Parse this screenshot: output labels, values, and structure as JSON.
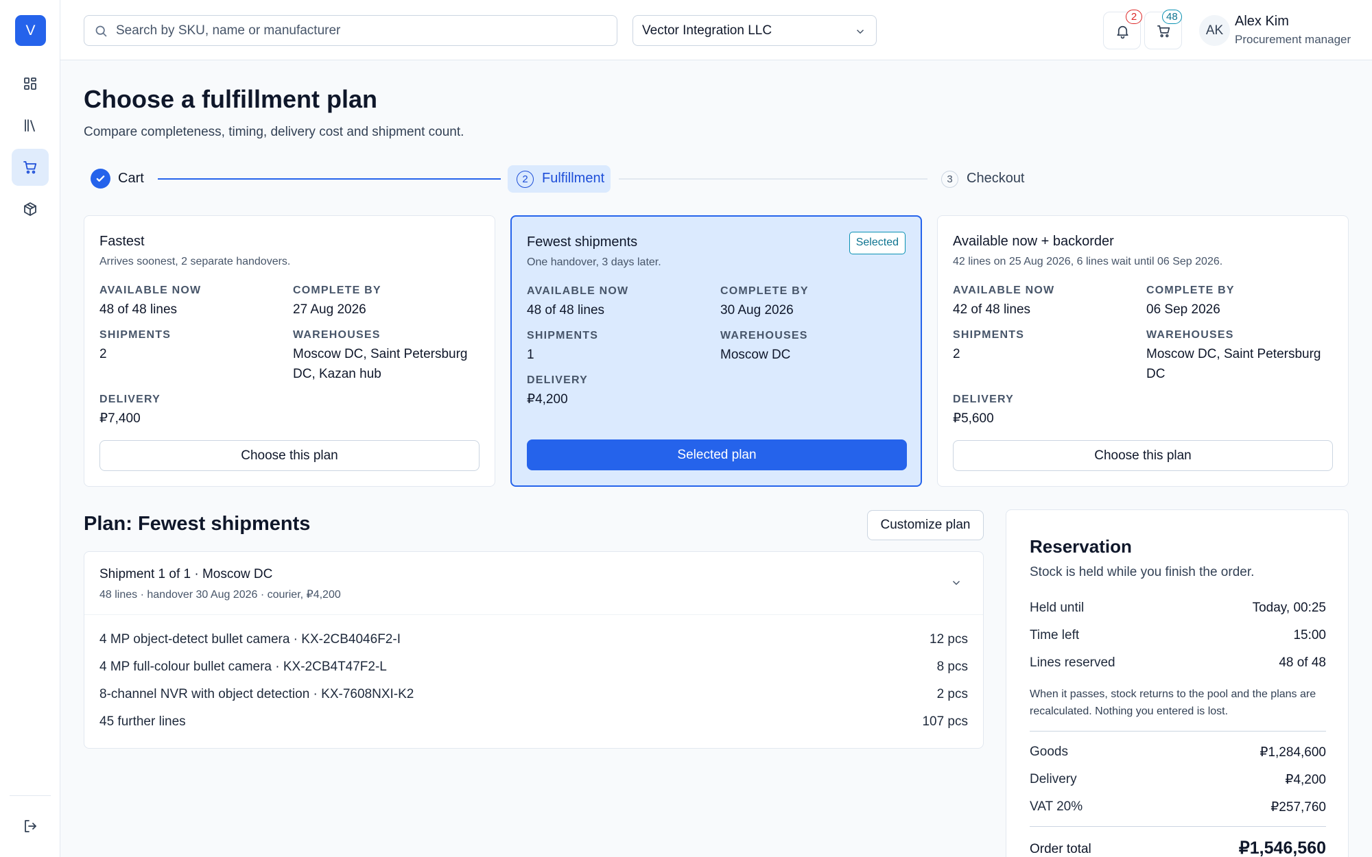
{
  "app": {
    "logo_letter": "V"
  },
  "header": {
    "search_placeholder": "Search by SKU, name or manufacturer",
    "company": "Vector Integration LLC",
    "notifications_count": "2",
    "cart_count": "48",
    "user_initials": "AK",
    "user_name": "Alex Kim",
    "user_role": "Procurement manager"
  },
  "sidebar": {
    "items": [
      {
        "icon": "dashboard-icon",
        "active": false
      },
      {
        "icon": "catalog-icon",
        "active": false
      },
      {
        "icon": "cart-icon",
        "active": true
      },
      {
        "icon": "package-icon",
        "active": false
      }
    ],
    "logout_icon": "logout-icon"
  },
  "page": {
    "title": "Choose a fulfillment plan",
    "subtitle": "Compare completeness, timing, delivery cost and shipment count."
  },
  "stepper": {
    "steps": [
      {
        "number": "1",
        "label": "Cart",
        "status": "done"
      },
      {
        "number": "2",
        "label": "Fulfillment",
        "status": "active"
      },
      {
        "number": "3",
        "label": "Checkout",
        "status": "upcoming"
      }
    ]
  },
  "labels": {
    "available_now": "Available now",
    "complete_by": "Complete by",
    "shipments": "Shipments",
    "warehouses": "Warehouses",
    "delivery": "Delivery"
  },
  "plans": [
    {
      "name": "Fastest",
      "description": "Arrives soonest, 2 separate handovers.",
      "available_now": "48 of 48 lines",
      "complete_by": "27 Aug 2026",
      "shipments": "2",
      "warehouses": "Moscow DC, Saint Petersburg DC, Kazan hub",
      "delivery": "₽7,400",
      "button": "Choose this plan",
      "selected": false
    },
    {
      "name": "Fewest shipments",
      "description": "One handover, 3 days later.",
      "available_now": "48 of 48 lines",
      "complete_by": "30 Aug 2026",
      "shipments": "1",
      "warehouses": "Moscow DC",
      "delivery": "₽4,200",
      "button": "Selected plan",
      "badge": "Selected",
      "selected": true
    },
    {
      "name": "Available now + backorder",
      "description": "42 lines on 25 Aug 2026, 6 lines wait until 06 Sep 2026.",
      "available_now": "42 of 48 lines",
      "complete_by": "06 Sep 2026",
      "shipments": "2",
      "warehouses": "Moscow DC, Saint Petersburg DC",
      "delivery": "₽5,600",
      "button": "Choose this plan",
      "selected": false
    }
  ],
  "plan_detail": {
    "title": "Plan: Fewest shipments",
    "customize_label": "Customize plan",
    "shipment": {
      "title": "Shipment 1 of 1 · Moscow DC",
      "meta": "48 lines · handover 30 Aug 2026 · courier, ₽4,200",
      "lines": [
        {
          "name": "4 MP object-detect bullet camera · KX-2CB4046F2-I",
          "qty": "12 pcs"
        },
        {
          "name": "4 MP full-colour bullet camera · KX-2CB4T47F2-L",
          "qty": "8 pcs"
        },
        {
          "name": "8-channel NVR with object detection · KX-7608NXI-K2",
          "qty": "2 pcs"
        },
        {
          "name": "45 further lines",
          "qty": "107 pcs"
        }
      ]
    }
  },
  "reservation": {
    "title": "Reservation",
    "subtitle": "Stock is held while you finish the order.",
    "rows": [
      {
        "label": "Held until",
        "value": "Today, 00:25"
      },
      {
        "label": "Time left",
        "value": "15:00"
      },
      {
        "label": "Lines reserved",
        "value": "48 of 48"
      }
    ],
    "note": "When it passes, stock returns to the pool and the plans are recalculated. Nothing you entered is lost.",
    "summary": [
      {
        "label": "Goods",
        "value": "₽1,284,600"
      },
      {
        "label": "Delivery",
        "value": "₽4,200"
      },
      {
        "label": "VAT 20%",
        "value": "₽257,760"
      }
    ],
    "total_label": "Order total",
    "total_value": "₽1,546,560"
  },
  "colors": {
    "accent": "#2563eb",
    "selected_bg": "#dbeafe",
    "badge_red": "#dc2626",
    "badge_teal": "#0891b2"
  }
}
